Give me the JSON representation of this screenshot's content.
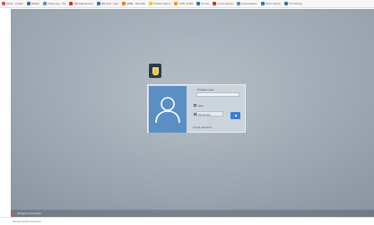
{
  "bookmarks": [
    {
      "label": "Infinity · On Mac",
      "icon": "bookmark-favicon",
      "color": "#d9534f"
    },
    {
      "label": "NASDA",
      "icon": "bookmark-favicon",
      "color": "#3a6fb5"
    },
    {
      "label": "Travel Long · The",
      "icon": "bookmark-favicon",
      "color": "#5b8fc4"
    },
    {
      "label": "TED Talks Rumors",
      "icon": "bookmark-favicon",
      "color": "#c0392b"
    },
    {
      "label": "IAM Tools · Apps",
      "icon": "bookmark-favicon",
      "color": "#3a6fb5"
    },
    {
      "label": "SIMPL · Mac APE",
      "icon": "bookmark-favicon",
      "color": "#e67e22"
    },
    {
      "label": "TFA Docs Site In",
      "icon": "bookmark-favicon",
      "color": "#e8c838"
    },
    {
      "label": "TOPIC SITES",
      "icon": "bookmark-favicon",
      "color": "#f39c12"
    },
    {
      "label": "On Hire",
      "icon": "bookmark-favicon",
      "color": "#3a6fb5"
    },
    {
      "label": "Let On Harness",
      "icon": "bookmark-favicon",
      "color": "#c0392b"
    },
    {
      "label": "Insure Harbour",
      "icon": "bookmark-favicon",
      "color": "#5b8fc4"
    },
    {
      "label": "Teams Chat Ht",
      "icon": "bookmark-favicon",
      "color": "#3a6fb5"
    },
    {
      "label": "TIoT Sharing",
      "icon": "bookmark-favicon",
      "color": "#3a6fb5"
    }
  ],
  "login": {
    "username_label": "Privilege Users",
    "option_label": "Auto",
    "remember_label": "Remember",
    "footer_label": "Forgot password"
  },
  "status_bar": {
    "text": "Workspace Connection"
  },
  "bottom_strip": {
    "text": "Remote session connected"
  },
  "colors": {
    "avatar_bg": "#5b8fc4",
    "login_button": "#3a7fd0",
    "desktop_bg": "#a4afba"
  }
}
